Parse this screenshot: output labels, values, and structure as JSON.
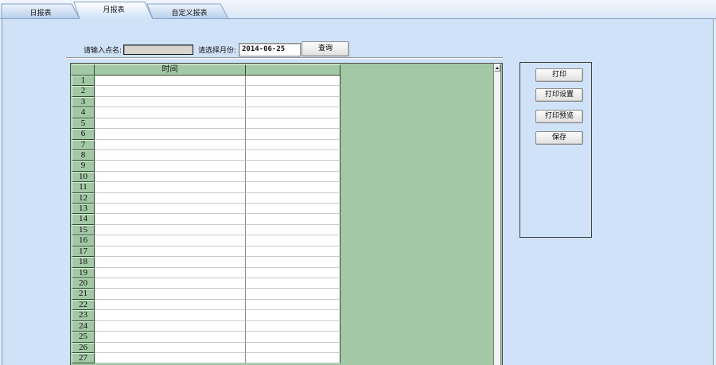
{
  "colors": {
    "panel_bg": "#cfe2f8",
    "grid_green": "#a3c8a5",
    "border_blue": "#7f9db9"
  },
  "tabs": [
    {
      "label": "日报表",
      "active": false
    },
    {
      "label": "月报表",
      "active": true
    },
    {
      "label": "自定义报表",
      "active": false
    }
  ],
  "query": {
    "point_label": "请输入点名:",
    "point_value": "",
    "month_label": "请选择月份:",
    "month_value": "2014-06-25",
    "query_button": "查询"
  },
  "grid": {
    "columns": [
      {
        "header": "时间"
      },
      {
        "header": ""
      }
    ],
    "rows": [
      "1",
      "2",
      "3",
      "4",
      "5",
      "6",
      "7",
      "8",
      "9",
      "10",
      "11",
      "12",
      "13",
      "14",
      "15",
      "16",
      "17",
      "18",
      "19",
      "20",
      "21",
      "22",
      "23",
      "24",
      "25",
      "26",
      "27"
    ],
    "scroll_up_icon": "arrow-up-icon"
  },
  "actions": {
    "print": "打印",
    "print_setup": "打印设置",
    "print_preview": "打印预览",
    "save": "保存"
  }
}
